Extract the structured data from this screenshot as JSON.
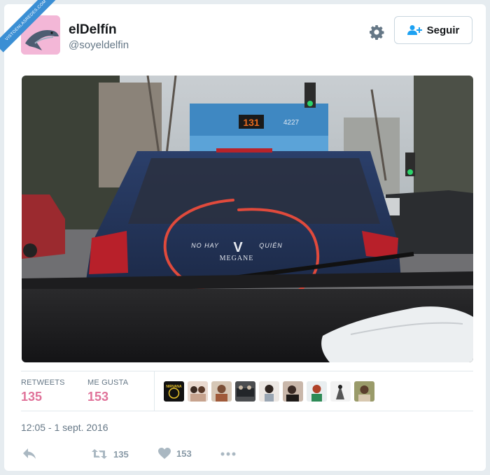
{
  "ribbon": {
    "text": "VISTOENLASREDES.COM"
  },
  "tweet": {
    "display_name": "elDelfín",
    "handle": "@soyeldelfin",
    "follow_label": "Seguir",
    "photo_sign_line1": "NO HAY",
    "photo_sign_logo": "V",
    "photo_sign_line2": "QUIÉN",
    "photo_model": "MEGANE",
    "photo_bus_route": "131",
    "photo_bus_number": "4227",
    "timestamp": "12:05 - 1 sept. 2016"
  },
  "stats": {
    "retweets_label": "RETWEETS",
    "retweets_value": "135",
    "likes_label": "ME GUSTA",
    "likes_value": "153",
    "liker_badge": "NIRVANA"
  },
  "actions": {
    "retweet_count": "135",
    "like_count": "153"
  },
  "colors": {
    "count_accent": "#e0739a",
    "avatar_bg": "#f3b7d7",
    "circle": "#e04a3c"
  }
}
